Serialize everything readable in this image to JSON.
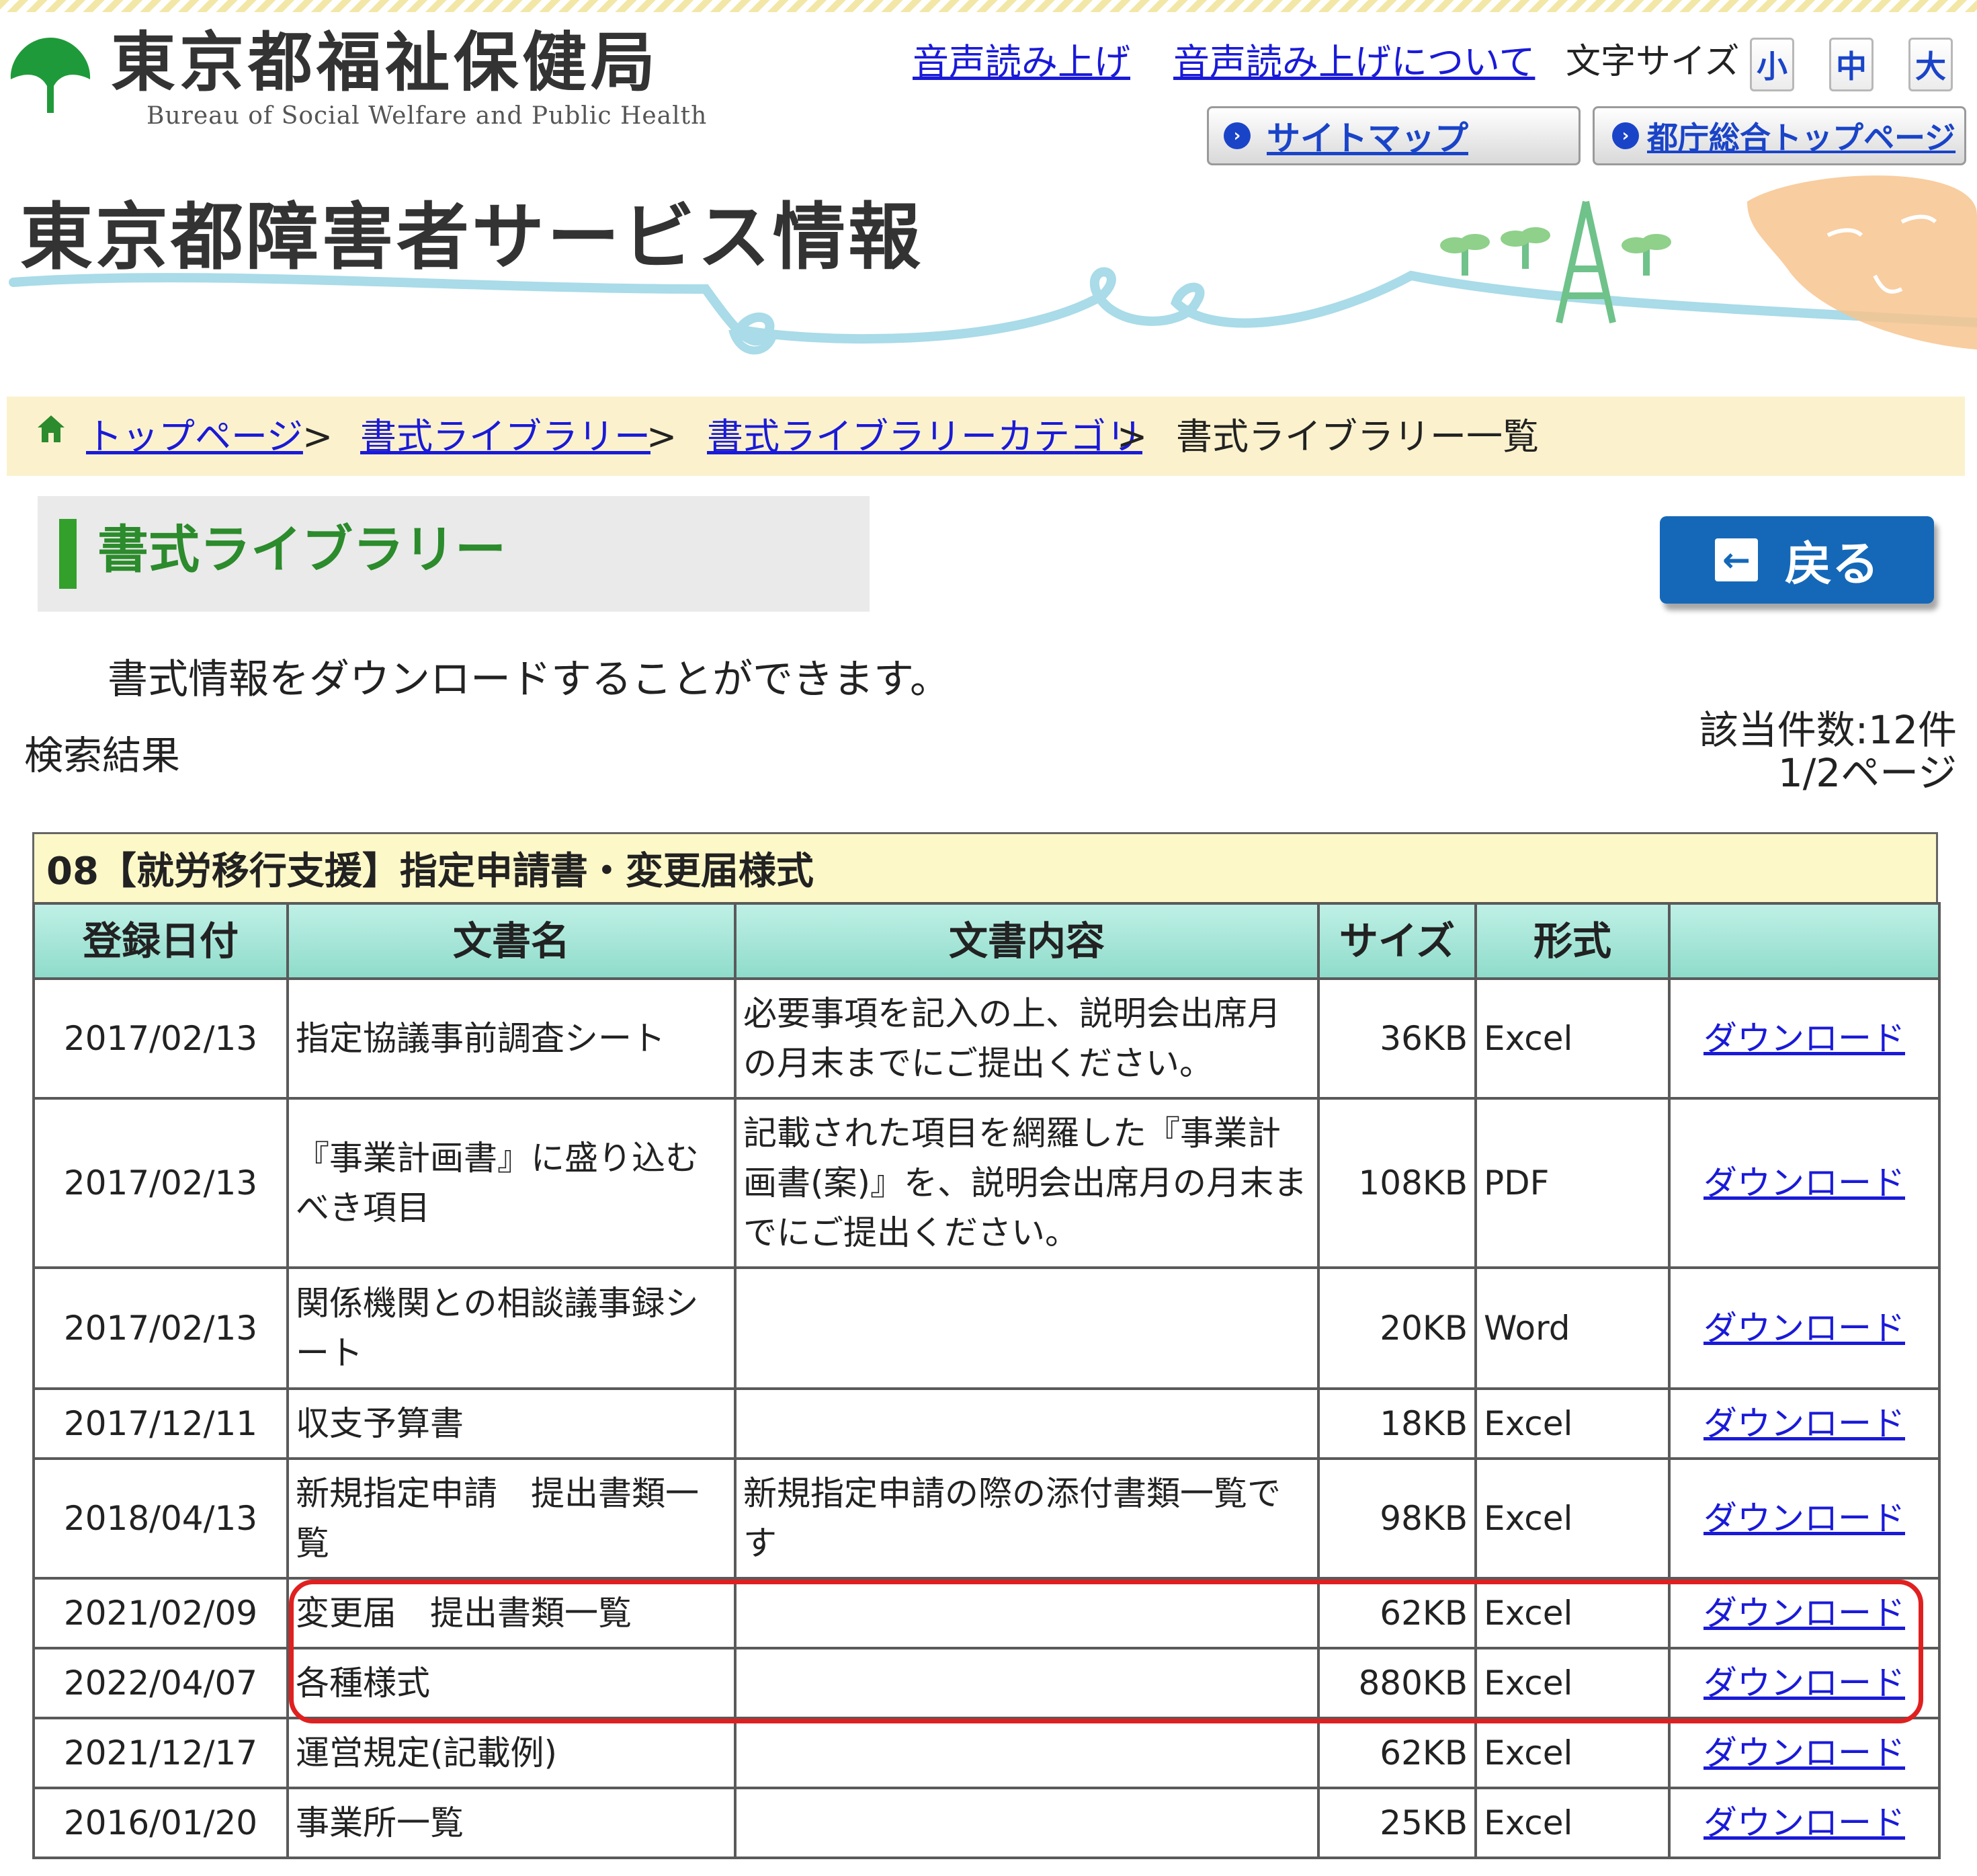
{
  "header": {
    "org_name": "東京都福祉保健局",
    "org_name_en": "Bureau of  Social  Welfare and Public Health",
    "links": [
      "音声読み上げ",
      "音声読み上げについて"
    ],
    "font_size_label": "文字サイズ",
    "font_sizes": [
      "小",
      "中",
      "大"
    ],
    "sitemap_label": "サイトマップ",
    "tokyo_top_label": "都庁総合トップページ",
    "site_title": "東京都障害者サービス情報"
  },
  "breadcrumb": {
    "items": [
      "トップページ",
      "書式ライブラリー",
      "書式ライブラリーカテゴリ",
      "書式ライブラリー一覧"
    ],
    "separator": ">"
  },
  "page": {
    "heading": "書式ライブラリー",
    "back_label": "戻る",
    "intro": "書式情報をダウンロードすることができます。",
    "results_label": "検索結果",
    "count": "該当件数:12件",
    "page_info": "1/2ページ"
  },
  "table": {
    "caption": "08【就労移行支援】指定申請書・変更届様式",
    "headers": [
      "登録日付",
      "文書名",
      "文書内容",
      "サイズ",
      "形式",
      ""
    ],
    "rows": [
      {
        "date": "2017/02/13",
        "name": "指定協議事前調査シート",
        "content": "必要事項を記入の上、説明会出席月の月末までにご提出ください。",
        "size": "36KB",
        "format": "Excel",
        "link": "ダウンロード"
      },
      {
        "date": "2017/02/13",
        "name": "『事業計画書』に盛り込むべき項目",
        "content": "記載された項目を網羅した『事業計画書(案)』を、説明会出席月の月末までにご提出ください。",
        "size": "108KB",
        "format": "PDF",
        "link": "ダウンロード"
      },
      {
        "date": "2017/02/13",
        "name": "関係機関との相談議事録シート",
        "content": "",
        "size": "20KB",
        "format": "Word",
        "link": "ダウンロード"
      },
      {
        "date": "2017/12/11",
        "name": "収支予算書",
        "content": "",
        "size": "18KB",
        "format": "Excel",
        "link": "ダウンロード"
      },
      {
        "date": "2018/04/13",
        "name": "新規指定申請　提出書類一覧",
        "content": "新規指定申請の際の添付書類一覧です",
        "size": "98KB",
        "format": "Excel",
        "link": "ダウンロード"
      },
      {
        "date": "2021/02/09",
        "name": "変更届　提出書類一覧",
        "content": "",
        "size": "62KB",
        "format": "Excel",
        "link": "ダウンロード"
      },
      {
        "date": "2022/04/07",
        "name": "各種様式",
        "content": "",
        "size": "880KB",
        "format": "Excel",
        "link": "ダウンロード"
      },
      {
        "date": "2021/12/17",
        "name": "運営規定(記載例)",
        "content": "",
        "size": "62KB",
        "format": "Excel",
        "link": "ダウンロード"
      },
      {
        "date": "2016/01/20",
        "name": "事業所一覧",
        "content": "",
        "size": "25KB",
        "format": "Excel",
        "link": "ダウンロード"
      }
    ]
  },
  "colors": {
    "brand_green": "#2c8b2c",
    "link_blue": "#1a1ad8",
    "button_blue": "#1568b8",
    "header_teal": "#8fdccb",
    "highlight_red": "#e02020"
  },
  "icons": [
    "tokyo-ginkgo-logo-icon",
    "home-icon",
    "arrow-circle-icon",
    "back-arrow-icon"
  ]
}
